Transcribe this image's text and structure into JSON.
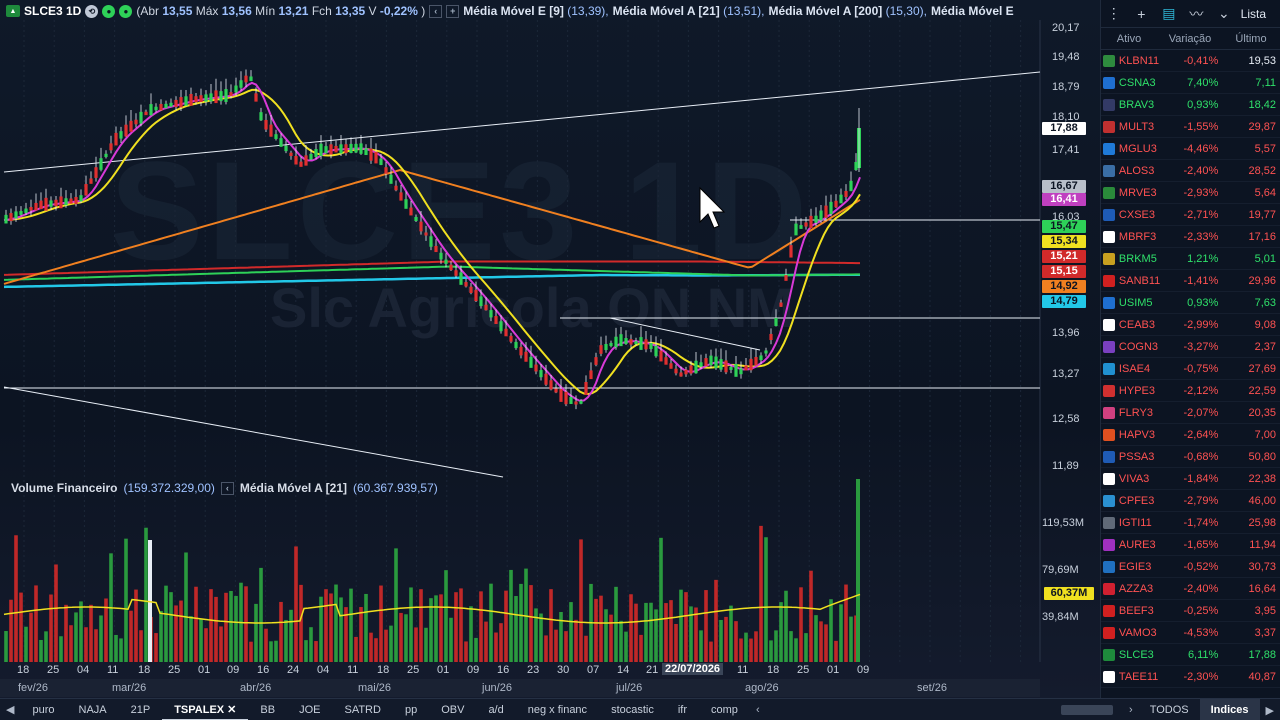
{
  "header": {
    "ticker": "SLCE3 1D",
    "ohlc_text": [
      "(Abr ",
      "13,55",
      " Máx ",
      "13,56",
      " Mín ",
      "13,21",
      " Fch ",
      "13,35",
      " V ",
      "-0,22%",
      " )"
    ],
    "ma1_label": "Média Móvel E [9]",
    "ma1_val": "(13,39),",
    "ma2_label": "Média Móvel A [21]",
    "ma2_val": "(13,51),",
    "ma3_label": "Média Móvel A [200]",
    "ma3_val": "(15,30),",
    "ma4_label": "Média Móvel E"
  },
  "watermark": {
    "ticker": "SLCE3 1D",
    "name": "Slc Agricola ON NM"
  },
  "volume_header": {
    "label": "Volume Financeiro",
    "value": "(159.372.329,00)",
    "ma_label": "Média Móvel A [21]",
    "ma_value": "(60.367.939,57)"
  },
  "price_axis": [
    "20,17",
    "19,48",
    "18,79",
    "18,10",
    "17,41",
    "16,03",
    "13,96",
    "13,27",
    "12,58",
    "11,89"
  ],
  "price_tags": [
    {
      "label": "17,88",
      "bg": "#ffffff",
      "fg": "#0c1422"
    },
    {
      "label": "16,67",
      "bg": "#b8bfc9",
      "fg": "#0c1422"
    },
    {
      "label": "16,41",
      "bg": "#c040c0",
      "fg": "#ffffff"
    },
    {
      "label": "15,47",
      "bg": "#2ed158",
      "fg": "#0c1422"
    },
    {
      "label": "15,34",
      "bg": "#f0e020",
      "fg": "#0c1422"
    },
    {
      "label": "15,21",
      "bg": "#d12a2a",
      "fg": "#ffffff"
    },
    {
      "label": "15,15",
      "bg": "#d12a2a",
      "fg": "#ffffff"
    },
    {
      "label": "14,92",
      "bg": "#f08020",
      "fg": "#0c1422"
    },
    {
      "label": "14,79",
      "bg": "#22c8e8",
      "fg": "#0c1422"
    }
  ],
  "volume_axis": [
    "119,53M",
    "79,69M",
    "60,37M",
    "39,84M"
  ],
  "x_ticks": [
    "18",
    "25",
    "04",
    "11",
    "18",
    "25",
    "01",
    "09",
    "16",
    "24",
    "04",
    "11",
    "18",
    "25",
    "01",
    "09",
    "16",
    "23",
    "30",
    "07",
    "14",
    "21",
    "22/07/2026",
    "11",
    "18",
    "25",
    "01",
    "09"
  ],
  "months": [
    "fev/26",
    "mar/26",
    "abr/26",
    "mai/26",
    "jun/26",
    "jul/26",
    "ago/26",
    "set/26"
  ],
  "sidebar": {
    "list_label": "Lista",
    "columns": [
      "Ativo",
      "Variação",
      "Último"
    ],
    "rows": [
      {
        "t": "KLBN11",
        "v": "-0,41%",
        "l": "19,53",
        "c": "#2e8b3e",
        "lc": "w"
      },
      {
        "t": "CSNA3",
        "v": "7,40%",
        "l": "7,11",
        "c": "#1f6fd0",
        "lc": "p"
      },
      {
        "t": "BRAV3",
        "v": "0,93%",
        "l": "18,42",
        "c": "#333a66",
        "lc": "p"
      },
      {
        "t": "MULT3",
        "v": "-1,55%",
        "l": "29,87",
        "c": "#c03030",
        "lc": "n"
      },
      {
        "t": "MGLU3",
        "v": "-4,46%",
        "l": "5,57",
        "c": "#1f7ad8",
        "lc": "n"
      },
      {
        "t": "ALOS3",
        "v": "-2,40%",
        "l": "28,52",
        "c": "#3a6ea5",
        "lc": "n"
      },
      {
        "t": "MRVE3",
        "v": "-2,93%",
        "l": "5,64",
        "c": "#2a8a3a",
        "lc": "n"
      },
      {
        "t": "CXSE3",
        "v": "-2,71%",
        "l": "19,77",
        "c": "#1e5bb5",
        "lc": "n"
      },
      {
        "t": "MBRF3",
        "v": "-2,33%",
        "l": "17,16",
        "c": "#ffffff",
        "lc": "n"
      },
      {
        "t": "BRKM5",
        "v": "1,21%",
        "l": "5,01",
        "c": "#c8a020",
        "lc": "p"
      },
      {
        "t": "SANB11",
        "v": "-1,41%",
        "l": "29,96",
        "c": "#d02020",
        "lc": "n"
      },
      {
        "t": "USIM5",
        "v": "0,93%",
        "l": "7,63",
        "c": "#1f6fd0",
        "lc": "p"
      },
      {
        "t": "CEAB3",
        "v": "-2,99%",
        "l": "9,08",
        "c": "#ffffff",
        "lc": "n"
      },
      {
        "t": "COGN3",
        "v": "-3,27%",
        "l": "2,37",
        "c": "#7a40c0",
        "lc": "n"
      },
      {
        "t": "ISAE4",
        "v": "-0,75%",
        "l": "27,69",
        "c": "#2090d0",
        "lc": "n"
      },
      {
        "t": "HYPE3",
        "v": "-2,12%",
        "l": "22,59",
        "c": "#d03030",
        "lc": "n"
      },
      {
        "t": "FLRY3",
        "v": "-2,07%",
        "l": "20,35",
        "c": "#d04080",
        "lc": "n"
      },
      {
        "t": "HAPV3",
        "v": "-2,64%",
        "l": "7,00",
        "c": "#e05020",
        "lc": "n"
      },
      {
        "t": "PSSA3",
        "v": "-0,68%",
        "l": "50,80",
        "c": "#1f5bb5",
        "lc": "n"
      },
      {
        "t": "VIVA3",
        "v": "-1,84%",
        "l": "22,38",
        "c": "#ffffff",
        "lc": "n"
      },
      {
        "t": "CPFE3",
        "v": "-2,79%",
        "l": "46,00",
        "c": "#2a90d0",
        "lc": "n"
      },
      {
        "t": "IGTI11",
        "v": "-1,74%",
        "l": "25,98",
        "c": "#606a78",
        "lc": "n"
      },
      {
        "t": "AURE3",
        "v": "-1,65%",
        "l": "11,94",
        "c": "#a030c0",
        "lc": "n"
      },
      {
        "t": "EGIE3",
        "v": "-0,52%",
        "l": "30,73",
        "c": "#2070c0",
        "lc": "n"
      },
      {
        "t": "AZZA3",
        "v": "-2,40%",
        "l": "16,64",
        "c": "#d02030",
        "lc": "n"
      },
      {
        "t": "BEEF3",
        "v": "-0,25%",
        "l": "3,95",
        "c": "#d02020",
        "lc": "n"
      },
      {
        "t": "VAMO3",
        "v": "-4,53%",
        "l": "3,37",
        "c": "#d02020",
        "lc": "n"
      },
      {
        "t": "SLCE3",
        "v": "6,11%",
        "l": "17,88",
        "c": "#1e8a3c",
        "lc": "p"
      },
      {
        "t": "TAEE11",
        "v": "-2,30%",
        "l": "40,87",
        "c": "#ffffff",
        "lc": "n"
      }
    ]
  },
  "bottom_tabs": [
    "puro",
    "NAJA",
    "21P",
    "TSPALEX",
    "BB",
    "JOE",
    "SATRD",
    "pp",
    "OBV",
    "a/d",
    "neg x financ",
    "stocastic",
    "ifr",
    "comp"
  ],
  "active_tab": "TSPALEX",
  "bottom_right": [
    "TODOS",
    "Indices"
  ]
}
